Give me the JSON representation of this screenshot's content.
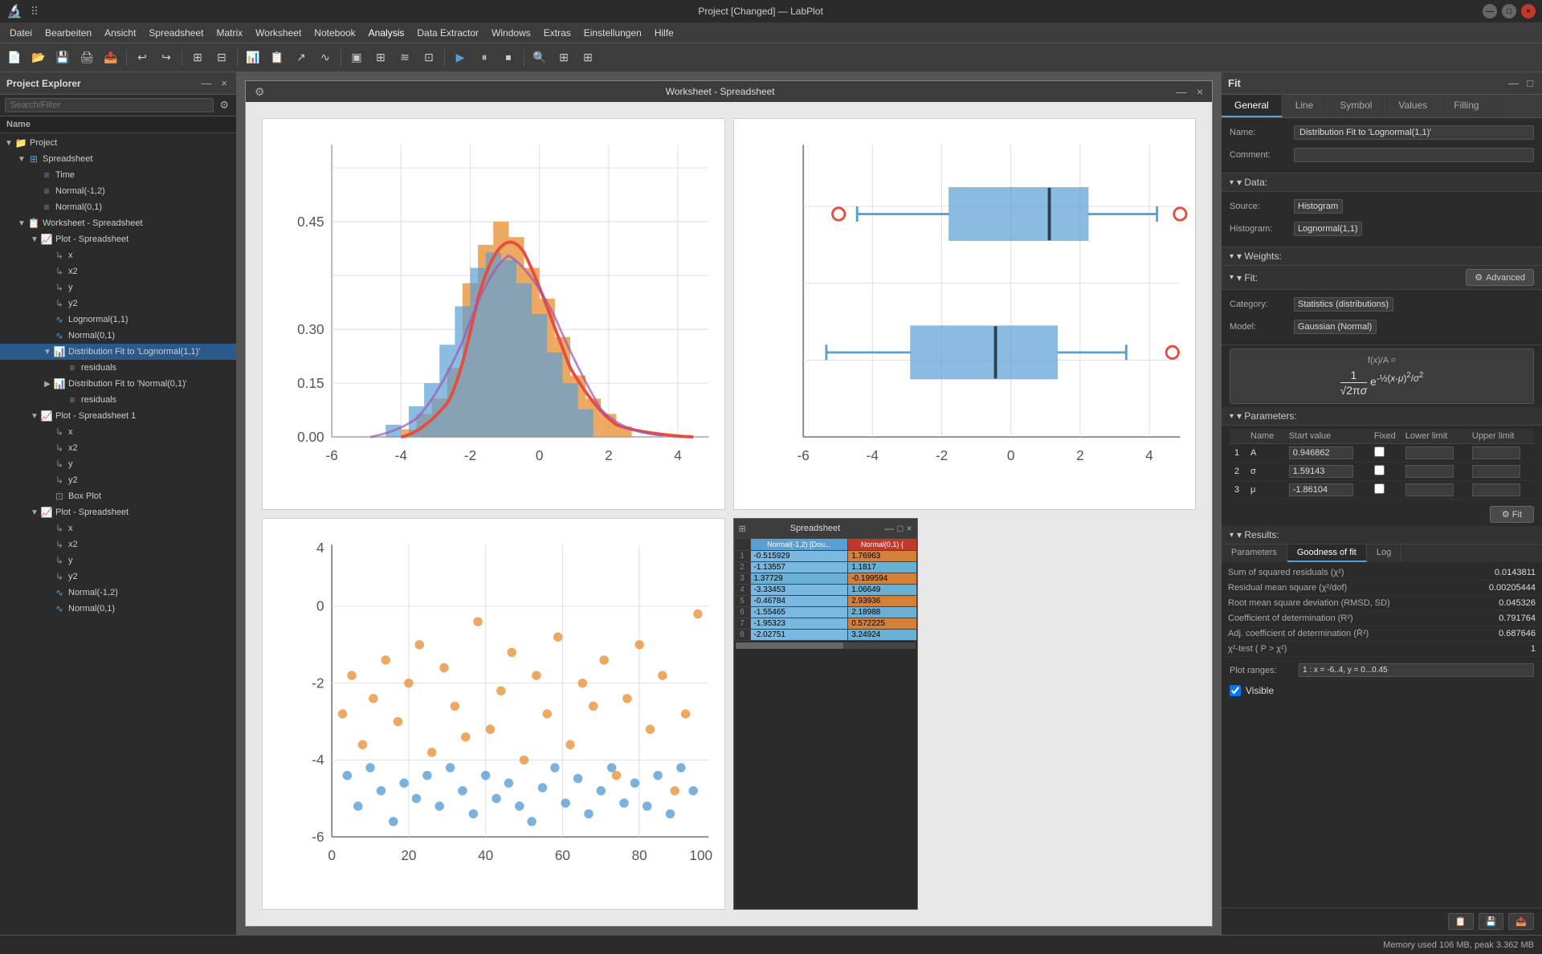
{
  "app": {
    "title": "Project [Changed] — LabPlot",
    "close_label": "×",
    "minimize_label": "—",
    "maximize_label": "□"
  },
  "menu": {
    "items": [
      "Datei",
      "Bearbeiten",
      "Ansicht",
      "Spreadsheet",
      "Matrix",
      "Worksheet",
      "Notebook",
      "Analysis",
      "Data Extractor",
      "Windows",
      "Extras",
      "Einstellungen",
      "Hilfe"
    ]
  },
  "project_explorer": {
    "title": "Project Explorer",
    "search_placeholder": "Search/Filter",
    "col_header": "Name",
    "tree": [
      {
        "id": "project",
        "label": "Project",
        "icon": "📁",
        "level": 0,
        "hasArrow": true
      },
      {
        "id": "spreadsheet",
        "label": "Spreadsheet",
        "icon": "⊞",
        "level": 1,
        "hasArrow": true
      },
      {
        "id": "time",
        "label": "Time",
        "icon": "≡",
        "level": 2,
        "hasArrow": false
      },
      {
        "id": "normal-1-2",
        "label": "Normal(-1,2)",
        "icon": "≡",
        "level": 2,
        "hasArrow": false
      },
      {
        "id": "normal-0-1",
        "label": "Normal(0,1)",
        "icon": "≡",
        "level": 2,
        "hasArrow": false
      },
      {
        "id": "worksheet-spreadsheet",
        "label": "Worksheet - Spreadsheet",
        "icon": "📋",
        "level": 1,
        "hasArrow": true
      },
      {
        "id": "plot-spreadsheet",
        "label": "Plot - Spreadsheet",
        "icon": "📈",
        "level": 2,
        "hasArrow": true
      },
      {
        "id": "x",
        "label": "x",
        "icon": "↗",
        "level": 3,
        "hasArrow": false
      },
      {
        "id": "x2",
        "label": "x2",
        "icon": "↗",
        "level": 3,
        "hasArrow": false
      },
      {
        "id": "y",
        "label": "y",
        "icon": "↗",
        "level": 3,
        "hasArrow": false
      },
      {
        "id": "y2",
        "label": "y2",
        "icon": "↗",
        "level": 3,
        "hasArrow": false
      },
      {
        "id": "lognormal",
        "label": "Lognormal(1,1)",
        "icon": "∿",
        "level": 3,
        "hasArrow": false
      },
      {
        "id": "normal01",
        "label": "Normal(0,1)",
        "icon": "∿",
        "level": 3,
        "hasArrow": false
      },
      {
        "id": "dist-fit-log",
        "label": "Distribution Fit to 'Lognormal(1,1)'",
        "icon": "📊",
        "level": 3,
        "hasArrow": true,
        "selected": true
      },
      {
        "id": "residuals1",
        "label": "residuals",
        "icon": "≡",
        "level": 4,
        "hasArrow": false
      },
      {
        "id": "dist-fit-norm",
        "label": "Distribution Fit to 'Normal(0,1)'",
        "icon": "📊",
        "level": 3,
        "hasArrow": true
      },
      {
        "id": "residuals2",
        "label": "residuals",
        "icon": "≡",
        "level": 4,
        "hasArrow": false
      },
      {
        "id": "plot-spreadsheet-1",
        "label": "Plot - Spreadsheet 1",
        "icon": "📈",
        "level": 2,
        "hasArrow": true
      },
      {
        "id": "x3",
        "label": "x",
        "icon": "↗",
        "level": 3,
        "hasArrow": false
      },
      {
        "id": "x4",
        "label": "x2",
        "icon": "↗",
        "level": 3,
        "hasArrow": false
      },
      {
        "id": "y3",
        "label": "y",
        "icon": "↗",
        "level": 3,
        "hasArrow": false
      },
      {
        "id": "y4",
        "label": "y2",
        "icon": "↗",
        "level": 3,
        "hasArrow": false
      },
      {
        "id": "box-plot",
        "label": "Box Plot",
        "icon": "⊡",
        "level": 3,
        "hasArrow": false
      },
      {
        "id": "plot-spreadsheet-2",
        "label": "Plot - Spreadsheet",
        "icon": "📈",
        "level": 2,
        "hasArrow": true
      },
      {
        "id": "x5",
        "label": "x",
        "icon": "↗",
        "level": 3,
        "hasArrow": false
      },
      {
        "id": "x6",
        "label": "x2",
        "icon": "↗",
        "level": 3,
        "hasArrow": false
      },
      {
        "id": "y5",
        "label": "y",
        "icon": "↗",
        "level": 3,
        "hasArrow": false
      },
      {
        "id": "y6",
        "label": "y2",
        "icon": "↗",
        "level": 3,
        "hasArrow": false
      },
      {
        "id": "normal-1-2b",
        "label": "Normal(-1,2)",
        "icon": "∿",
        "level": 3,
        "hasArrow": false
      },
      {
        "id": "normal-0-1b",
        "label": "Normal(0,1)",
        "icon": "∿",
        "level": 3,
        "hasArrow": false
      }
    ]
  },
  "worksheet": {
    "title": "Worksheet - Spreadsheet"
  },
  "spreadsheet_popup": {
    "title": "Spreadsheet",
    "columns": [
      "",
      "Normal(-1,2) [Dou...",
      "Normal(0,1) {"
    ],
    "rows": [
      {
        "num": "1",
        "col1": "-0.515929",
        "col2": "1.76963",
        "c1class": "negative",
        "c2class": "orange"
      },
      {
        "num": "2",
        "col1": "-1.13557",
        "col2": "1.1817",
        "c1class": "negative",
        "c2class": "blue"
      },
      {
        "num": "3",
        "col1": "1.37729",
        "col2": "-0.199594",
        "c1class": "blue",
        "c2class": "orange"
      },
      {
        "num": "4",
        "col1": "-3.33453",
        "col2": "1.06649",
        "c1class": "negative",
        "c2class": "blue"
      },
      {
        "num": "5",
        "col1": "-0.46784",
        "col2": "2.93936",
        "c1class": "negative",
        "c2class": "orange"
      },
      {
        "num": "6",
        "col1": "-1.55465",
        "col2": "2.18988",
        "c1class": "negative",
        "c2class": "blue"
      },
      {
        "num": "7",
        "col1": "-1.95323",
        "col2": "0.572225",
        "c1class": "negative",
        "c2class": "orange"
      },
      {
        "num": "8",
        "col1": "-2.02751",
        "col2": "3.24924",
        "c1class": "negative",
        "c2class": "blue"
      }
    ]
  },
  "fit_panel": {
    "title": "Fit",
    "tabs": [
      "General",
      "Line",
      "Symbol",
      "Values",
      "Filling"
    ],
    "name_label": "Name:",
    "name_value": "Distribution Fit to 'Lognormal(1,1)'",
    "comment_label": "Comment:",
    "comment_value": "",
    "data_section": "▾ Data:",
    "source_label": "Source:",
    "source_value": "Histogram",
    "histogram_label": "Histogram:",
    "histogram_value": "Lognormal(1,1)",
    "weights_section": "▾ Weights:",
    "fit_section": "▾ Fit:",
    "advanced_label": "Advanced",
    "category_label": "Category:",
    "category_value": "Statistics (distributions)",
    "model_label": "Model:",
    "model_value": "Gaussian (Normal)",
    "formula_label": "f(x)/A =",
    "formula": "1/(√(2πσ)) · e^(-½((x-μ)/σ)²)",
    "parameters_section": "▾ Parameters:",
    "param_tabs": [
      "Name",
      "Start value",
      "Fixed",
      "Lower limit",
      "Upper limit"
    ],
    "params": [
      {
        "num": "1",
        "name": "A",
        "start_value": "0.946862",
        "fixed": false
      },
      {
        "num": "2",
        "name": "σ",
        "start_value": "1.59143",
        "fixed": false
      },
      {
        "num": "3",
        "name": "μ",
        "start_value": "-1.86104",
        "fixed": false
      }
    ],
    "fit_button": "⚙ Fit",
    "results_section": "▾ Results:",
    "result_tabs": [
      "Parameters",
      "Goodness of fit",
      "Log"
    ],
    "results": [
      {
        "label": "Sum of squared residuals (χ²)",
        "value": "0.0143811"
      },
      {
        "label": "Residual mean square (χ²/dof)",
        "value": "0.00205444"
      },
      {
        "label": "Root mean square deviation (RMSD, SD)",
        "value": "0.045326"
      },
      {
        "label": "Coefficient of determination (R²)",
        "value": "0.791764"
      },
      {
        "label": "Adj. coefficient of determination (R̄²)",
        "value": "0.687646"
      },
      {
        "label": "χ²-test ( P > χ²)",
        "value": "1"
      }
    ],
    "plot_ranges_label": "Plot ranges:",
    "plot_ranges_value": "1 : x = -6..4, y = 0...0.45",
    "visible_label": "Visible",
    "visible_checked": true
  },
  "bottom_bar": {
    "memory_label": "Memory used 106 MB, peak 3.362 MB"
  }
}
